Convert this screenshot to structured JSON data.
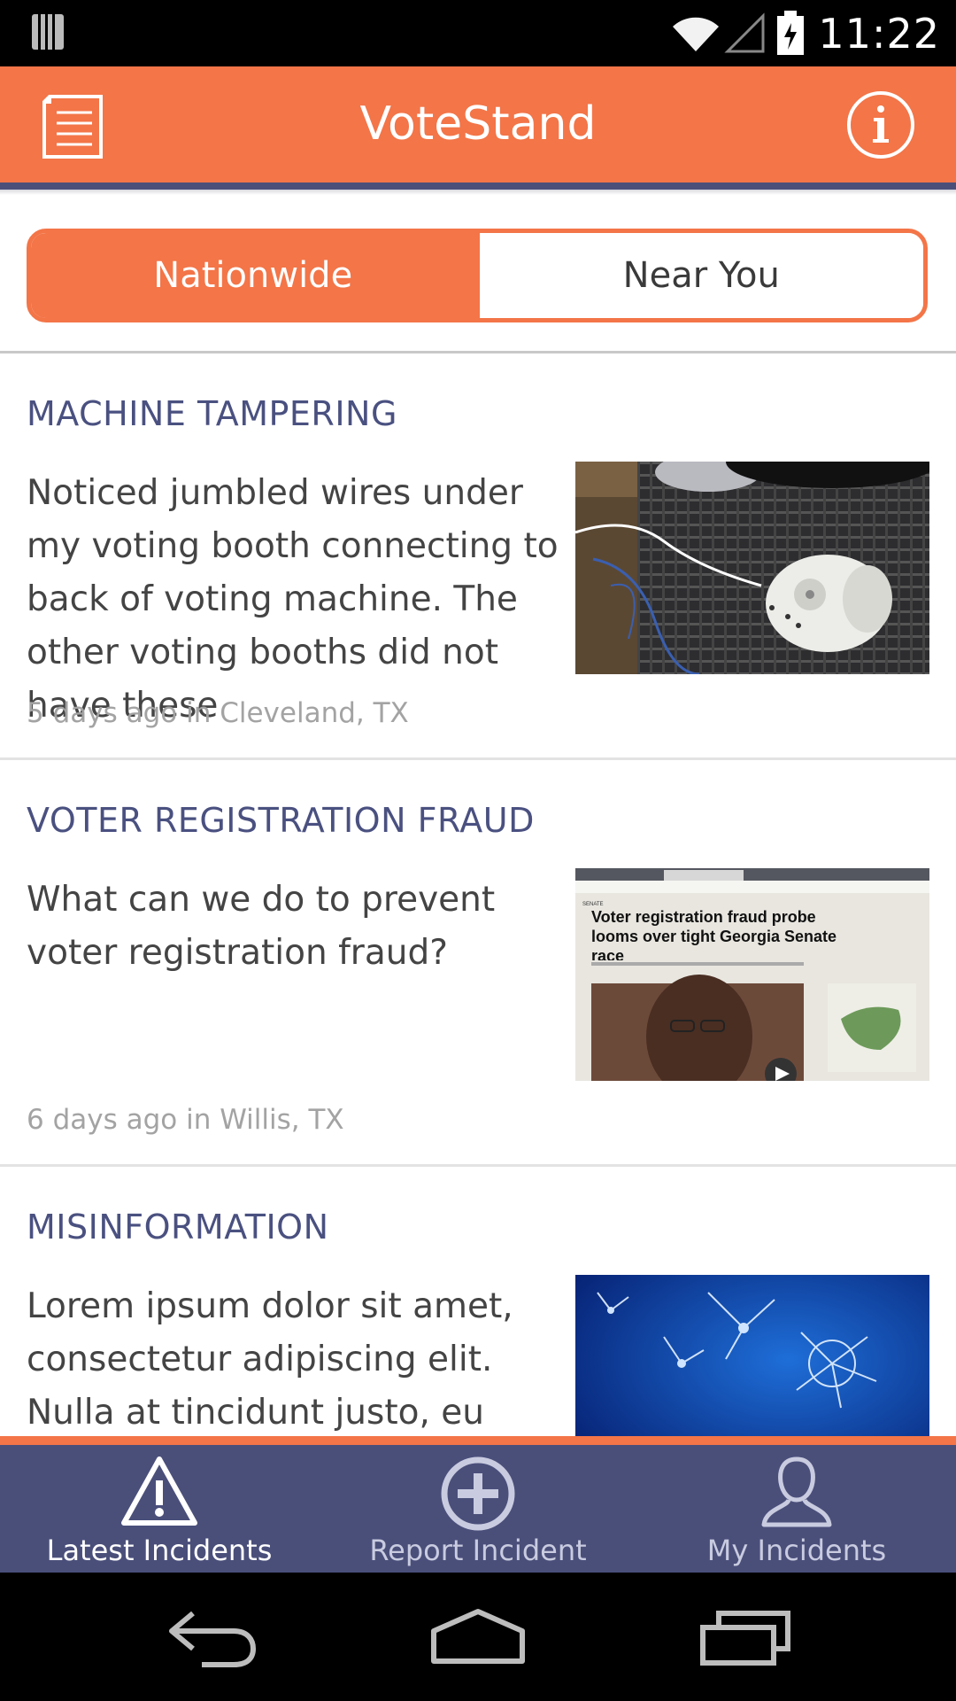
{
  "status_bar": {
    "time": "11:22",
    "icons": [
      "notification-icon",
      "wifi-icon",
      "signal-icon",
      "battery-icon"
    ]
  },
  "app_bar": {
    "title": "VoteStand",
    "menu_icon": "list-icon",
    "info_icon": "info-icon",
    "accent_color": "#f37548",
    "underline_color": "#4a4f7a"
  },
  "segment": {
    "options": [
      "Nationwide",
      "Near You"
    ],
    "selected": "Nationwide"
  },
  "incidents": [
    {
      "category": "MACHINE TAMPERING",
      "text": "Noticed jumbled wires under my voting booth connecting to back of voting machine.  The other voting booths did not have these",
      "meta": "5 days ago in Cleveland, TX",
      "thumbnail": "photo of wires and a small white fan on carpet"
    },
    {
      "category": "VOTER REGISTRATION FRAUD",
      "text": "What can we do to prevent voter registration fraud?",
      "meta": "6 days ago in Willis, TX",
      "thumbnail": "screenshot of a news article",
      "thumb_headline": "Voter registration fraud probe looms over tight Georgia Senate race",
      "thumb_section": "SENATE"
    },
    {
      "category": "MISINFORMATION",
      "text": "Lorem ipsum dolor sit amet, consectetur adipiscing elit. Nulla at tincidunt justo, eu maximus",
      "meta": "",
      "thumbnail": "photo of dandelion seeds on blue background"
    }
  ],
  "bottom_nav": {
    "items": [
      {
        "label": "Latest Incidents",
        "icon": "warning-icon",
        "active": true
      },
      {
        "label": "Report Incident",
        "icon": "plus-circle-icon",
        "active": false
      },
      {
        "label": "My Incidents",
        "icon": "person-icon",
        "active": false
      }
    ],
    "background": "#4a4f7a"
  },
  "system_nav": [
    "back-icon",
    "home-icon",
    "recents-icon"
  ]
}
